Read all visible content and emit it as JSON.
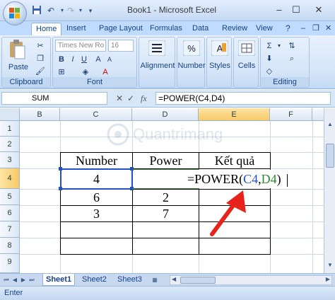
{
  "window": {
    "title": "Book1 - Microsoft Excel"
  },
  "quick_access": {
    "save_icon": "save-icon",
    "undo_icon": "undo-icon",
    "redo_icon": "redo-icon"
  },
  "tabs": [
    {
      "label": "Home"
    },
    {
      "label": "Insert"
    },
    {
      "label": "Page Layout"
    },
    {
      "label": "Formulas"
    },
    {
      "label": "Data"
    },
    {
      "label": "Review"
    },
    {
      "label": "View"
    }
  ],
  "ribbon": {
    "clipboard": {
      "label": "Clipboard",
      "paste_label": "Paste"
    },
    "font": {
      "label": "Font",
      "font_name": "Times New Ro",
      "font_size": "16"
    },
    "alignment": {
      "label": "Alignment"
    },
    "number": {
      "label": "Number"
    },
    "styles": {
      "label": "Styles"
    },
    "cells": {
      "label": "Cells"
    },
    "editing": {
      "label": "Editing"
    }
  },
  "formula_bar": {
    "name_box": "SUM",
    "cancel": "✕",
    "enter": "✓",
    "fx": "fx",
    "formula": "=POWER(C4,D4)"
  },
  "columns": [
    "B",
    "C",
    "D",
    "E",
    "F"
  ],
  "rows": [
    "1",
    "2",
    "3",
    "4",
    "5",
    "6",
    "7",
    "8",
    "9"
  ],
  "table": {
    "headers": [
      "Number",
      "Power",
      "Kết quả"
    ],
    "rows": [
      {
        "number": "4",
        "power": "",
        "result": ""
      },
      {
        "number": "6",
        "power": "2",
        "result": ""
      },
      {
        "number": "3",
        "power": "7",
        "result": ""
      }
    ],
    "edit_prefix": "=POWER(",
    "edit_ref1": "C4",
    "edit_comma": ",",
    "edit_ref2": "D4",
    "edit_suffix": ")"
  },
  "watermark": "Quantrimang",
  "sheets": [
    {
      "label": "Sheet1"
    },
    {
      "label": "Sheet2"
    },
    {
      "label": "Sheet3"
    }
  ],
  "status": {
    "mode": "Enter"
  },
  "colors": {
    "ribbon_bg": "#d5e5f8",
    "ref1_color": "#1f4fd8",
    "ref2_color": "#2e8b2e",
    "arrow_color": "#e8231b"
  }
}
